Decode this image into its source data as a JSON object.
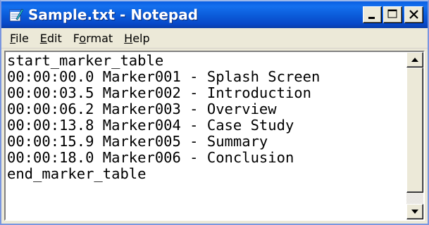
{
  "window": {
    "title": "Sample.txt - Notepad",
    "app_icon": "notepad-icon",
    "buttons": {
      "minimize": "minimize-icon",
      "maximize": "maximize-icon",
      "close": "close-icon"
    }
  },
  "menu": {
    "items": [
      {
        "label": "File",
        "accel": "F",
        "rest": "ile"
      },
      {
        "label": "Edit",
        "accel": "E",
        "rest": "dit"
      },
      {
        "label": "Format",
        "pre": "F",
        "accel": "o",
        "rest": "rmat"
      },
      {
        "label": "Help",
        "accel": "H",
        "rest": "elp"
      }
    ]
  },
  "document": {
    "lines": [
      "start_marker_table",
      "00:00:00.0 Marker001 - Splash Screen",
      "00:00:03.5 Marker002 - Introduction",
      "00:00:06.2 Marker003 - Overview",
      "00:00:13.8 Marker004 - Case Study",
      "00:00:15.9 Marker005 - Summary",
      "00:00:18.0 Marker006 - Conclusion",
      "end_marker_table"
    ]
  },
  "scrollbar": {
    "up_icon": "scroll-up-arrow-icon",
    "down_icon": "scroll-down-arrow-icon",
    "thumb_position": 0.0
  },
  "colors": {
    "titlebar": "#0a5fe2",
    "chrome": "#ece9d8"
  }
}
